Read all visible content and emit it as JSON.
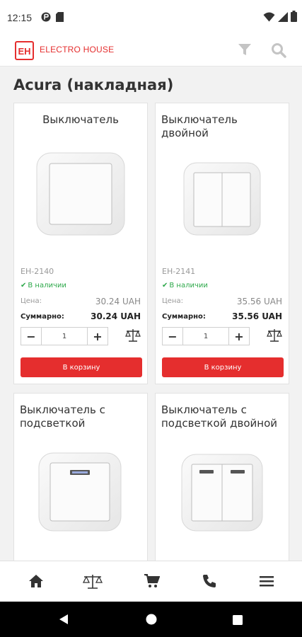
{
  "status_bar": {
    "time": "12:15"
  },
  "header": {
    "brand_name": "ELECTRO HOUSE",
    "logo_letters": "EH",
    "brand_color": "#e52e2e"
  },
  "page": {
    "title": "Acura (накладная)"
  },
  "labels": {
    "in_stock": "В наличии",
    "price": "Цена:",
    "total": "Суммарно:",
    "add_to_cart": "В корзину",
    "minus": "−",
    "plus": "+"
  },
  "products": [
    {
      "title": "Выключатель",
      "sku": "EH-2140",
      "price": "30.24 UAH",
      "total": "30.24 UAH",
      "qty": "1"
    },
    {
      "title": "Выключатель двойной",
      "sku": "EH-2141",
      "price": "35.56 UAH",
      "total": "35.56 UAH",
      "qty": "1"
    },
    {
      "title": "Выключатель с подсветкой",
      "sku": "",
      "price": "",
      "total": "",
      "qty": ""
    },
    {
      "title": "Выключатель с подсветкой двойной",
      "sku": "",
      "price": "",
      "total": "",
      "qty": ""
    }
  ],
  "bottom_nav": [
    "home-icon",
    "compare-icon",
    "cart-icon",
    "phone-icon",
    "menu-icon"
  ]
}
